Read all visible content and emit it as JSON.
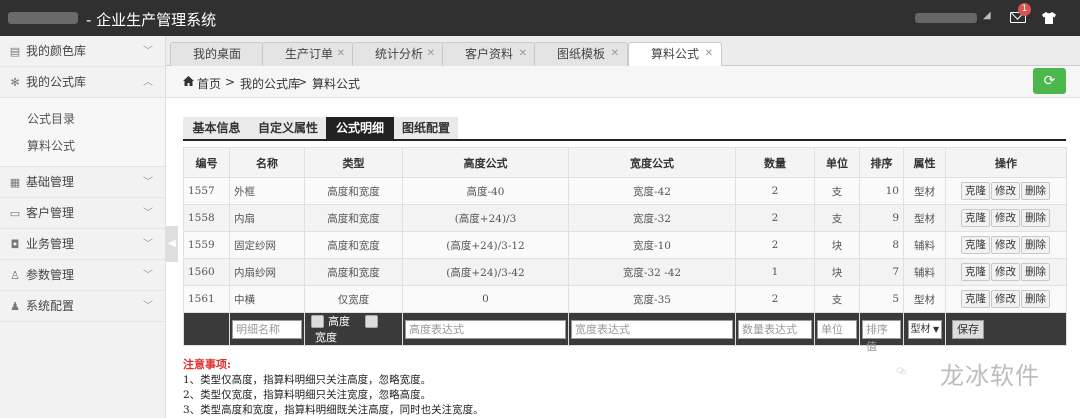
{
  "header": {
    "title": "- 企业生产管理系统",
    "mail_badge": "1"
  },
  "sidebar": {
    "items": [
      {
        "label": "我的颜色库",
        "icon": "palette-icon"
      },
      {
        "label": "我的公式库",
        "icon": "gear-icon"
      },
      {
        "label": "基础管理",
        "icon": "grid-icon"
      },
      {
        "label": "客户管理",
        "icon": "card-icon"
      },
      {
        "label": "业务管理",
        "icon": "lock-icon"
      },
      {
        "label": "参数管理",
        "icon": "user-icon"
      },
      {
        "label": "系统配置",
        "icon": "person-icon"
      }
    ],
    "subitems": [
      "公式目录",
      "算料公式"
    ]
  },
  "tabs": [
    {
      "label": "我的桌面"
    },
    {
      "label": "生产订单"
    },
    {
      "label": "统计分析"
    },
    {
      "label": "客户资料"
    },
    {
      "label": "图纸模板"
    },
    {
      "label": "算料公式"
    }
  ],
  "breadcrumb": {
    "home": "首页",
    "sep1": ">",
    "level1": "我的公式库",
    "sep2": ">",
    "current": "算料公式"
  },
  "subtabs": [
    "基本信息",
    "自定义属性",
    "公式明细",
    "图纸配置"
  ],
  "table": {
    "columns": [
      "编号",
      "名称",
      "类型",
      "高度公式",
      "宽度公式",
      "数量",
      "单位",
      "排序",
      "属性",
      "操作"
    ],
    "rows": [
      {
        "id": "1557",
        "name": "外框",
        "type": "高度和宽度",
        "height": "高度-40",
        "width": "宽度-42",
        "qty": "2",
        "unit": "支",
        "order": "10",
        "attr": "型材"
      },
      {
        "id": "1558",
        "name": "内扇",
        "type": "高度和宽度",
        "height": "(高度+24)/3",
        "width": "宽度-32",
        "qty": "2",
        "unit": "支",
        "order": "9",
        "attr": "型材"
      },
      {
        "id": "1559",
        "name": "固定纱网",
        "type": "高度和宽度",
        "height": "(高度+24)/3-12",
        "width": "宽度-10",
        "qty": "2",
        "unit": "块",
        "order": "8",
        "attr": "辅料"
      },
      {
        "id": "1560",
        "name": "内扇纱网",
        "type": "高度和宽度",
        "height": "(高度+24)/3-42",
        "width": "宽度-32 -42",
        "qty": "1",
        "unit": "块",
        "order": "7",
        "attr": "辅料"
      },
      {
        "id": "1561",
        "name": "中横",
        "type": "仅宽度",
        "height": "0",
        "width": "宽度-35",
        "qty": "2",
        "unit": "支",
        "order": "5",
        "attr": "型材"
      }
    ],
    "ops": {
      "clone": "克隆",
      "edit": "修改",
      "delete": "删除"
    }
  },
  "addrow": {
    "name_ph": "明细名称",
    "height_chk": "高度",
    "width_chk": "宽度",
    "height_expr_ph": "高度表达式",
    "width_expr_ph": "宽度表达式",
    "qty_ph": "数量表达式",
    "unit_ph": "单位",
    "order_ph": "排序值",
    "attr_value": "型材",
    "save": "保存"
  },
  "notes": {
    "title": "注意事项:",
    "lines": [
      "1、类型仅高度，指算料明细只关注高度，忽略宽度。",
      "2、类型仅宽度，指算料明细只关注宽度，忽略高度。",
      "3、类型高度和宽度，指算料明细既关注高度，同时也关注宽度。"
    ]
  },
  "watermark": "龙冰软件"
}
